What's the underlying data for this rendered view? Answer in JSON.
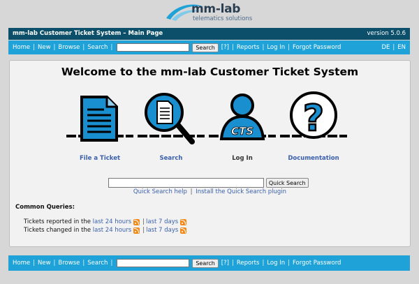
{
  "logo": {
    "brand": "mm-lab",
    "tagline": "telematics solutions"
  },
  "titlebar": {
    "title": "mm-lab Customer Ticket System – Main Page",
    "version": "version 5.0.6"
  },
  "nav": {
    "home": "Home",
    "new": "New",
    "browse": "Browse",
    "search": "Search",
    "search_button": "Search",
    "help": "[?]",
    "reports": "Reports",
    "login": "Log In",
    "forgot": "Forgot Password",
    "search_value": ""
  },
  "lang": {
    "de": "DE",
    "sep": "|",
    "en": "EN"
  },
  "main": {
    "welcome": "Welcome to the mm-lab Customer Ticket System",
    "tiles": [
      {
        "label": "File a Ticket",
        "icon": "document-icon"
      },
      {
        "label": "Search",
        "icon": "magnifier-icon"
      },
      {
        "label": "Log In",
        "icon": "user-cts-icon"
      },
      {
        "label": "Documentation",
        "icon": "question-mark-icon"
      }
    ],
    "cts_text": "CTS",
    "question_glyph": "?",
    "quick_search": {
      "value": "",
      "button": "Quick Search"
    },
    "quick_links": {
      "help": "Quick Search help",
      "sep": "|",
      "install": "Install the Quick Search plugin"
    },
    "common_title": "Common Queries:",
    "queries": [
      {
        "text": "Tickets reported in the",
        "link1": "last 24 hours",
        "sep": "|",
        "link2": "last 7 days"
      },
      {
        "text": "Tickets changed in the",
        "link1": "last 24 hours",
        "sep": "|",
        "link2": "last 7 days"
      }
    ]
  },
  "colors": {
    "titlebar": "#0b4f6a",
    "navbar": "#1ea2d8",
    "icon_blue": "#1a8fd0",
    "link": "#3a5fae"
  }
}
